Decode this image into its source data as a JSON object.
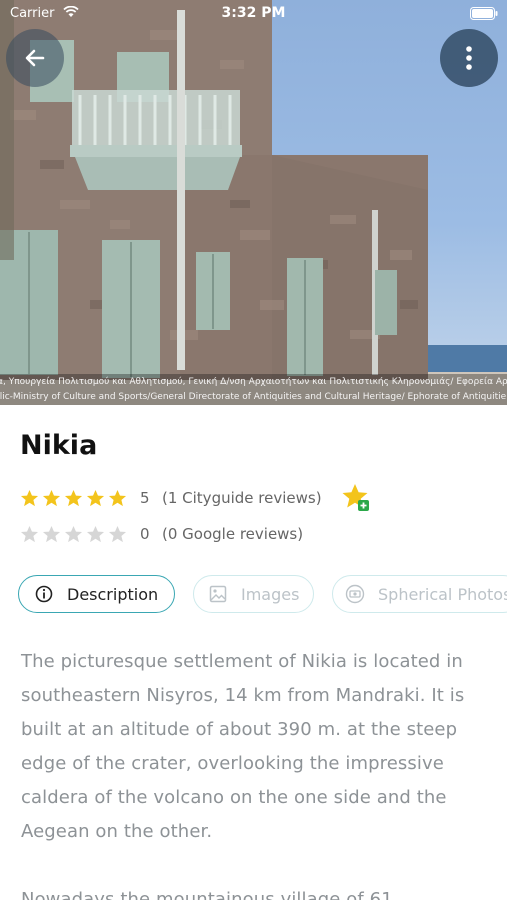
{
  "status_bar": {
    "carrier": "Carrier",
    "time": "3:32 PM"
  },
  "hero": {
    "photo_description_icon": "hero-photo",
    "credit_text": "ία, Υπουργεία Πολιτισμού και Αθλητισμού, Γενική Δ/νση Αρχαιοτήτων και Πολιτιστικής Κληρονομιάς/ Εφορεία Αρχαιοτήτων\nblic-Ministry of Culture and Sports/General Directorate of Antiquities and Cultural Heritage/ Ephorate of Antiquitie"
  },
  "nav": {
    "back_icon": "arrow-left-icon",
    "more_icon": "more-vertical-icon"
  },
  "place": {
    "title": "Nikia"
  },
  "ratings": {
    "cityguide": {
      "stars": 5,
      "count": "5",
      "label": "(1 Cityguide reviews)"
    },
    "google": {
      "stars": 0,
      "count": "0",
      "label": "(0 Google reviews)"
    }
  },
  "favorite": {
    "icon": "star-add-icon"
  },
  "tabs": [
    {
      "label": "Description",
      "icon": "info-circle-icon",
      "active": true
    },
    {
      "label": "Images",
      "icon": "image-icon",
      "active": false
    },
    {
      "label": "Spherical Photos",
      "icon": "panorama-icon",
      "active": false
    }
  ],
  "description": {
    "paragraph_1": "The picturesque settlement of Nikia is located in southeastern Nisyros, 14 km from Mandraki. It is built at an altitude of about 390 m. at the steep edge of the crater, overlooking the impressive caldera of the volcano on the one side and the Aegean on the other.",
    "paragraph_2": "Nowadays the mountainous village of 61"
  },
  "colors": {
    "accent": "#3aa7b3",
    "star_filled": "#f3c41c",
    "star_empty": "#d6d6d6"
  }
}
